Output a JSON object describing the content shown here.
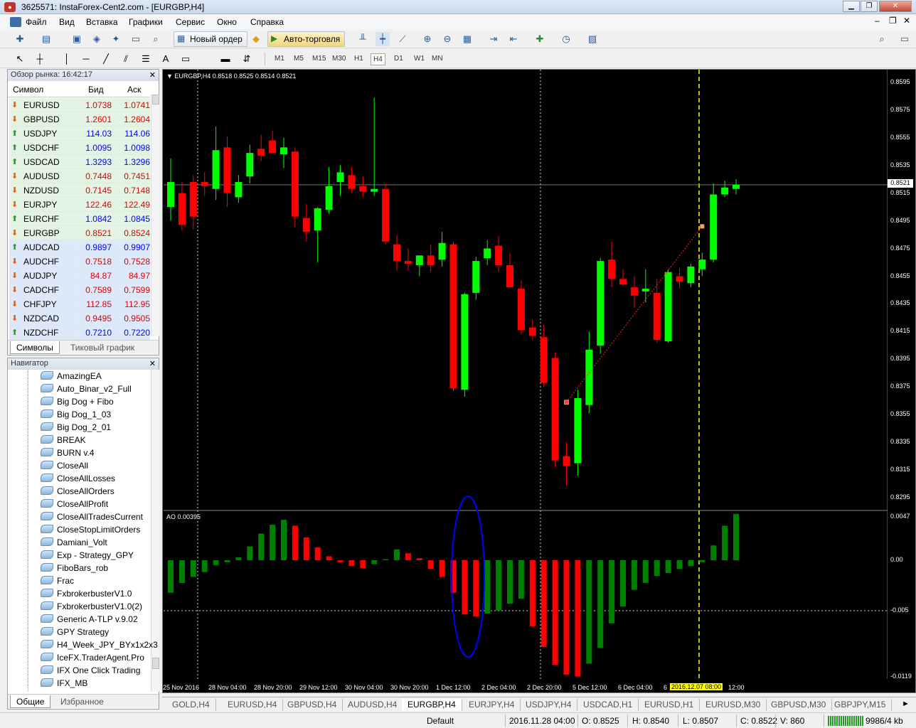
{
  "window": {
    "title": "3625571: InstaForex-Cent2.com - [EURGBP,H4]"
  },
  "menu": [
    "Файл",
    "Вид",
    "Вставка",
    "Графики",
    "Сервис",
    "Окно",
    "Справка"
  ],
  "toolbar": {
    "new_order": "Новый ордер",
    "auto_trading": "Авто-торговля",
    "text_tool": "A"
  },
  "timeframes": [
    "M1",
    "M5",
    "M15",
    "M30",
    "H1",
    "H4",
    "D1",
    "W1",
    "MN"
  ],
  "market_watch": {
    "title": "Обзор рынка: 16:42:17",
    "col_symbol": "Символ",
    "col_bid": "Бид",
    "col_ask": "Аск",
    "rows": [
      {
        "symbol": "EURUSD",
        "bid": "1.0738",
        "ask": "1.0741",
        "dir": "down"
      },
      {
        "symbol": "GBPUSD",
        "bid": "1.2601",
        "ask": "1.2604",
        "dir": "down"
      },
      {
        "symbol": "USDJPY",
        "bid": "114.03",
        "ask": "114.06",
        "dir": "up"
      },
      {
        "symbol": "USDCHF",
        "bid": "1.0095",
        "ask": "1.0098",
        "dir": "up"
      },
      {
        "symbol": "USDCAD",
        "bid": "1.3293",
        "ask": "1.3296",
        "dir": "up"
      },
      {
        "symbol": "AUDUSD",
        "bid": "0.7448",
        "ask": "0.7451",
        "dir": "down"
      },
      {
        "symbol": "NZDUSD",
        "bid": "0.7145",
        "ask": "0.7148",
        "dir": "down"
      },
      {
        "symbol": "EURJPY",
        "bid": "122.46",
        "ask": "122.49",
        "dir": "down"
      },
      {
        "symbol": "EURCHF",
        "bid": "1.0842",
        "ask": "1.0845",
        "dir": "up"
      },
      {
        "symbol": "EURGBP",
        "bid": "0.8521",
        "ask": "0.8524",
        "dir": "down"
      },
      {
        "symbol": "AUDCAD",
        "bid": "0.9897",
        "ask": "0.9907",
        "dir": "up"
      },
      {
        "symbol": "AUDCHF",
        "bid": "0.7518",
        "ask": "0.7528",
        "dir": "down"
      },
      {
        "symbol": "AUDJPY",
        "bid": "84.87",
        "ask": "84.97",
        "dir": "down"
      },
      {
        "symbol": "CADCHF",
        "bid": "0.7589",
        "ask": "0.7599",
        "dir": "down"
      },
      {
        "symbol": "CHFJPY",
        "bid": "112.85",
        "ask": "112.95",
        "dir": "down"
      },
      {
        "symbol": "NZDCAD",
        "bid": "0.9495",
        "ask": "0.9505",
        "dir": "down"
      },
      {
        "symbol": "NZDCHF",
        "bid": "0.7210",
        "ask": "0.7220",
        "dir": "up"
      }
    ],
    "tabs": [
      "Символы",
      "Тиковый график"
    ]
  },
  "navigator": {
    "title": "Навигатор",
    "items": [
      "AmazingEA",
      "Auto_Binar_v2_Full",
      "Big Dog + Fibo",
      "Big Dog_1_03",
      "Big Dog_2_01",
      "BREAK",
      "BURN v.4",
      "CloseAll",
      "CloseAllLosses",
      "CloseAllOrders",
      "CloseAllProfit",
      "CloseAllTradesCurrent",
      "CloseStopLimitOrders",
      "Damiani_Volt",
      "Exp - Strategy_GPY",
      "FiboBars_rob",
      "Frac",
      "FxbrokerbusterV1.0",
      "FxbrokerbusterV1.0(2)",
      "Generic A-TLP v.9.02",
      "GPY Strategy",
      "H4_Week_JPY_BYx1x2x3",
      "IceFX.TraderAgent.Pro",
      "IFX One Click Trading",
      "IFX_MB"
    ],
    "tabs": [
      "Общие",
      "Избранное"
    ]
  },
  "chart": {
    "info": "EURGBP,H4  0.8518 0.8525 0.8514 0.8521",
    "price_label": "0.8521",
    "ao_label": "AO 0.00395",
    "y_labels": [
      "0.8595",
      "0.8575",
      "0.8555",
      "0.8535",
      "0.8515",
      "0.8495",
      "0.8475",
      "0.8455",
      "0.8435",
      "0.8415",
      "0.8395",
      "0.8375",
      "0.8355",
      "0.8335",
      "0.8315",
      "0.8295"
    ],
    "ao_labels": [
      "0.0047",
      "0.00",
      "-0.005",
      "-0.0119"
    ],
    "x_labels": [
      "25 Nov 2016",
      "28 Nov 04:00",
      "28 Nov 20:00",
      "29 Nov 12:00",
      "30 Nov 04:00",
      "30 Nov 20:00",
      "1 Dec 12:00",
      "2 Dec 04:00",
      "2 Dec 20:00",
      "5 Dec 12:00",
      "6 Dec 04:00",
      "6",
      "12:00"
    ],
    "x_highlight": "2016.12.07 08:00"
  },
  "chart_data": {
    "type": "candlestick",
    "symbol": "EURGBP",
    "timeframe": "H4",
    "ylim": [
      0.829,
      0.86
    ],
    "candles": [
      {
        "o": 0.8505,
        "h": 0.854,
        "l": 0.8495,
        "c": 0.8523
      },
      {
        "o": 0.8515,
        "h": 0.8523,
        "l": 0.8488,
        "c": 0.8492
      },
      {
        "o": 0.8523,
        "h": 0.8528,
        "l": 0.8489,
        "c": 0.8498
      },
      {
        "o": 0.8523,
        "h": 0.853,
        "l": 0.8513,
        "c": 0.852
      },
      {
        "o": 0.8518,
        "h": 0.8563,
        "l": 0.851,
        "c": 0.8546
      },
      {
        "o": 0.8548,
        "h": 0.8556,
        "l": 0.8505,
        "c": 0.8515
      },
      {
        "o": 0.8512,
        "h": 0.8528,
        "l": 0.8508,
        "c": 0.8523
      },
      {
        "o": 0.8527,
        "h": 0.855,
        "l": 0.8522,
        "c": 0.8544
      },
      {
        "o": 0.8547,
        "h": 0.8557,
        "l": 0.8538,
        "c": 0.8542
      },
      {
        "o": 0.8553,
        "h": 0.856,
        "l": 0.8548,
        "c": 0.8544
      },
      {
        "o": 0.8543,
        "h": 0.8555,
        "l": 0.8533,
        "c": 0.8548
      },
      {
        "o": 0.8545,
        "h": 0.8548,
        "l": 0.849,
        "c": 0.8498
      },
      {
        "o": 0.8497,
        "h": 0.8507,
        "l": 0.848,
        "c": 0.8487
      },
      {
        "o": 0.8488,
        "h": 0.8505,
        "l": 0.8465,
        "c": 0.8504
      },
      {
        "o": 0.8503,
        "h": 0.8534,
        "l": 0.85,
        "c": 0.852
      },
      {
        "o": 0.8523,
        "h": 0.8535,
        "l": 0.8513,
        "c": 0.853
      },
      {
        "o": 0.8528,
        "h": 0.8534,
        "l": 0.8515,
        "c": 0.8518
      },
      {
        "o": 0.852,
        "h": 0.8527,
        "l": 0.8512,
        "c": 0.8516
      },
      {
        "o": 0.8516,
        "h": 0.8584,
        "l": 0.8513,
        "c": 0.8518
      },
      {
        "o": 0.8518,
        "h": 0.8521,
        "l": 0.8478,
        "c": 0.848
      },
      {
        "o": 0.8478,
        "h": 0.8485,
        "l": 0.8459,
        "c": 0.8466
      },
      {
        "o": 0.8466,
        "h": 0.8475,
        "l": 0.8459,
        "c": 0.8464
      },
      {
        "o": 0.8463,
        "h": 0.847,
        "l": 0.8455,
        "c": 0.847
      },
      {
        "o": 0.847,
        "h": 0.8478,
        "l": 0.8458,
        "c": 0.8463
      },
      {
        "o": 0.8467,
        "h": 0.8487,
        "l": 0.8462,
        "c": 0.8479
      },
      {
        "o": 0.8478,
        "h": 0.848,
        "l": 0.8372,
        "c": 0.8374
      },
      {
        "o": 0.8373,
        "h": 0.8443,
        "l": 0.8368,
        "c": 0.8442
      },
      {
        "o": 0.8443,
        "h": 0.8469,
        "l": 0.8438,
        "c": 0.8466
      },
      {
        "o": 0.8468,
        "h": 0.8481,
        "l": 0.8463,
        "c": 0.8475
      },
      {
        "o": 0.8477,
        "h": 0.8484,
        "l": 0.8458,
        "c": 0.8463
      },
      {
        "o": 0.8463,
        "h": 0.8472,
        "l": 0.8447,
        "c": 0.8447
      },
      {
        "o": 0.8446,
        "h": 0.8452,
        "l": 0.8413,
        "c": 0.8416
      },
      {
        "o": 0.8418,
        "h": 0.8424,
        "l": 0.8409,
        "c": 0.8412
      },
      {
        "o": 0.8411,
        "h": 0.842,
        "l": 0.8375,
        "c": 0.8378
      },
      {
        "o": 0.8396,
        "h": 0.84,
        "l": 0.8317,
        "c": 0.8322
      },
      {
        "o": 0.8325,
        "h": 0.8335,
        "l": 0.8304,
        "c": 0.8318
      },
      {
        "o": 0.832,
        "h": 0.8373,
        "l": 0.8311,
        "c": 0.8367
      },
      {
        "o": 0.8362,
        "h": 0.8415,
        "l": 0.8356,
        "c": 0.8402
      },
      {
        "o": 0.8405,
        "h": 0.8468,
        "l": 0.8399,
        "c": 0.8466
      },
      {
        "o": 0.8467,
        "h": 0.848,
        "l": 0.8447,
        "c": 0.8453
      },
      {
        "o": 0.8453,
        "h": 0.846,
        "l": 0.8448,
        "c": 0.8449
      },
      {
        "o": 0.8447,
        "h": 0.8455,
        "l": 0.8432,
        "c": 0.8441
      },
      {
        "o": 0.8444,
        "h": 0.846,
        "l": 0.8436,
        "c": 0.8446
      },
      {
        "o": 0.8443,
        "h": 0.8453,
        "l": 0.8407,
        "c": 0.8409
      },
      {
        "o": 0.8408,
        "h": 0.846,
        "l": 0.8407,
        "c": 0.8458
      },
      {
        "o": 0.8455,
        "h": 0.8461,
        "l": 0.8446,
        "c": 0.8451
      },
      {
        "o": 0.845,
        "h": 0.8464,
        "l": 0.8447,
        "c": 0.8462
      },
      {
        "o": 0.846,
        "h": 0.8472,
        "l": 0.8455,
        "c": 0.8467
      },
      {
        "o": 0.8467,
        "h": 0.8522,
        "l": 0.8465,
        "c": 0.8514
      },
      {
        "o": 0.8514,
        "h": 0.8524,
        "l": 0.8512,
        "c": 0.8519
      },
      {
        "o": 0.8518,
        "h": 0.8525,
        "l": 0.8514,
        "c": 0.8521
      }
    ],
    "ao": [
      -0.0033,
      -0.0023,
      -0.0017,
      -0.0012,
      -0.0005,
      -0.0002,
      0.0003,
      0.0014,
      0.0027,
      0.0036,
      0.0041,
      0.0035,
      0.0023,
      0.0013,
      0.0004,
      -0.0002,
      -0.0006,
      -0.0008,
      -0.0004,
      0.0001,
      0.0011,
      0.0007,
      0.0002,
      -0.0009,
      -0.0017,
      -0.0033,
      -0.0055,
      -0.0057,
      -0.0054,
      -0.0051,
      -0.0044,
      -0.0039,
      -0.0067,
      -0.0088,
      -0.0106,
      -0.0116,
      -0.0118,
      -0.0105,
      -0.0089,
      -0.0064,
      -0.0047,
      -0.003,
      -0.0023,
      -0.0016,
      -0.0013,
      -0.0009,
      -0.0006,
      -0.0002,
      0.0015,
      0.0035,
      0.0047
    ]
  },
  "chart_tabs": [
    "GOLD,H4",
    "EURUSD,H4",
    "GBPUSD,H4",
    "AUDUSD,H4",
    "EURGBP,H4",
    "EURJPY,H4",
    "USDJPY,H4",
    "USDCAD,H1",
    "EURUSD,H1",
    "EURUSD,M30",
    "GBPUSD,M30",
    "GBPJPY,M15"
  ],
  "status": {
    "profile": "Default",
    "time": "2016.11.28 04:00",
    "o": "O: 0.8525",
    "h": "H: 0.8540",
    "l": "L: 0.8507",
    "c": "C: 0.8522",
    "v": "V: 860",
    "traffic": "9986/4 kb"
  },
  "colors": {
    "bull": "#00ff00",
    "bear": "#ff0000",
    "ao_up": "#008000",
    "ao_down": "#ff0000",
    "highlight": "#ffff00"
  }
}
